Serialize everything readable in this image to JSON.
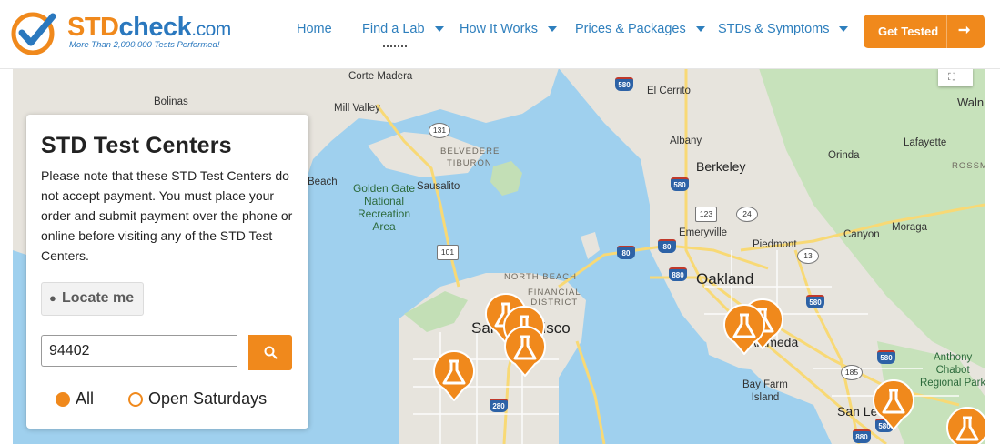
{
  "brand": {
    "name_part1": "STD",
    "name_part2": "check",
    "name_part3": ".com",
    "tagline": "More Than 2,000,000 Tests Performed!",
    "colors": {
      "orange": "#f0891c",
      "blue": "#2a78be"
    }
  },
  "nav": {
    "items": [
      {
        "label": "Home",
        "has_caret": false
      },
      {
        "label": "Find a Lab",
        "has_caret": true
      },
      {
        "label": "How It Works",
        "has_caret": true
      },
      {
        "label": "Prices & Packages",
        "has_caret": true
      },
      {
        "label": "STDs & Symptoms",
        "has_caret": true
      }
    ],
    "cta_label": "Get Tested",
    "cta_icon": "arrow-right-icon"
  },
  "panel": {
    "title": "STD Test Centers",
    "note": "Please note that these STD Test Centers do not accept payment. You must place your order and submit payment over the phone or online before visiting any of the STD Test Centers.",
    "locate_label": "Locate me",
    "locate_icon": "map-marker-icon",
    "zip_value": "94402",
    "search_icon": "search-icon",
    "filters": [
      {
        "label": "All",
        "selected": true
      },
      {
        "label": "Open Saturdays",
        "selected": false
      }
    ]
  },
  "map": {
    "labels": {
      "bolinas": "Bolinas",
      "corte_madera": "Corte Madera",
      "mill_valley": "Mill Valley",
      "belvedere": "BELVEDERE",
      "tiburon": "TIBURON",
      "beach": "Beach",
      "ggnra": "Golden Gate\nNational\nRecreation\nArea",
      "sausalito": "Sausalito",
      "north_beach": "NORTH BEACH",
      "financial": "FINANCIAL\nDISTRICT",
      "san_francisco": "San Francisco",
      "el_cerrito": "El Cerrito",
      "albany": "Albany",
      "berkeley": "Berkeley",
      "emeryville": "Emeryville",
      "piedmont": "Piedmont",
      "oakland": "Oakland",
      "alameda": "Alameda",
      "bay_farm": "Bay Farm\nIsland",
      "san_leandro": "San Le",
      "orinda": "Orinda",
      "lafayette": "Lafayette",
      "canyon": "Canyon",
      "moraga": "Moraga",
      "anthony_chabot": "Anthony\nChabot\nRegional Park",
      "walnut": "Waln",
      "rossmoor": "ROSSM"
    },
    "routes": [
      "580",
      "131",
      "580",
      "123",
      "24",
      "80",
      "80",
      "880",
      "13",
      "580",
      "101",
      "580",
      "185",
      "580",
      "280",
      "880",
      "13"
    ],
    "pin_icon": "flask-icon",
    "fullscreen_icon": "fullscreen-icon"
  }
}
